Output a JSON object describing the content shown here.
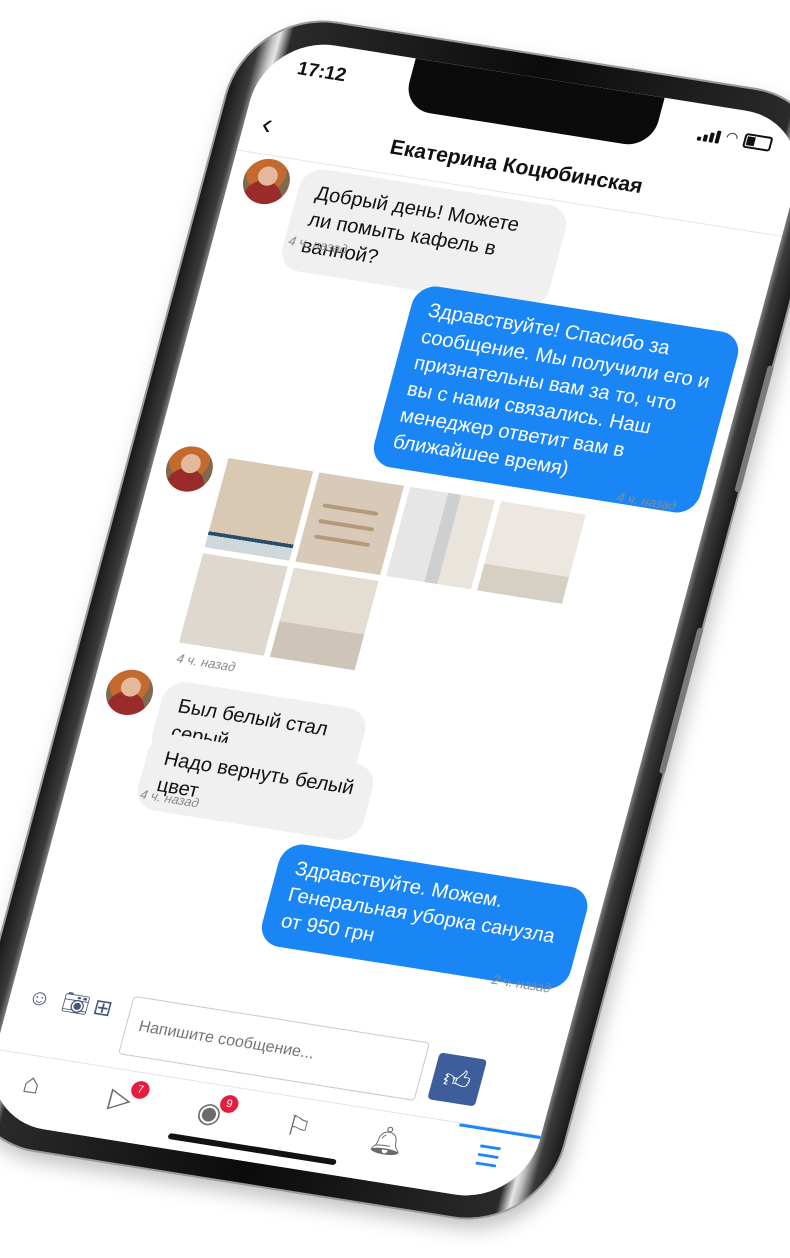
{
  "status_bar": {
    "time": "17:12"
  },
  "header": {
    "title": "Екатерина Коцюбинская"
  },
  "messages": [
    {
      "text": "Добрый день! Можете ли помыть кафель в ванной?",
      "time": "4 ч. назад"
    },
    {
      "text": "Здравствуйте! Спасибо за сообщение.  Мы получили его и признательны вам за то, что вы с нами связались. Наш менеджер ответит вам в ближайшее время)",
      "time": "4 ч. назад"
    },
    {
      "photos_time": "4 ч. назад"
    },
    {
      "text1": "Был белый стал серый",
      "text2": "Надо вернуть белый цвет",
      "time": "4 ч. назад"
    },
    {
      "text": "Здравствуйте. Можем. Генеральная уборка санузла от 950 грн",
      "time": "2 ч. назад"
    }
  ],
  "composer": {
    "placeholder": "Напишите сообщение..."
  },
  "tabbar": {
    "video_badge": "7",
    "groups_badge": "9"
  },
  "colors": {
    "accent": "#1a86f6",
    "bubble_in": "#f0f0f0",
    "badge": "#e41e3f",
    "like": "#3d5d9b"
  }
}
